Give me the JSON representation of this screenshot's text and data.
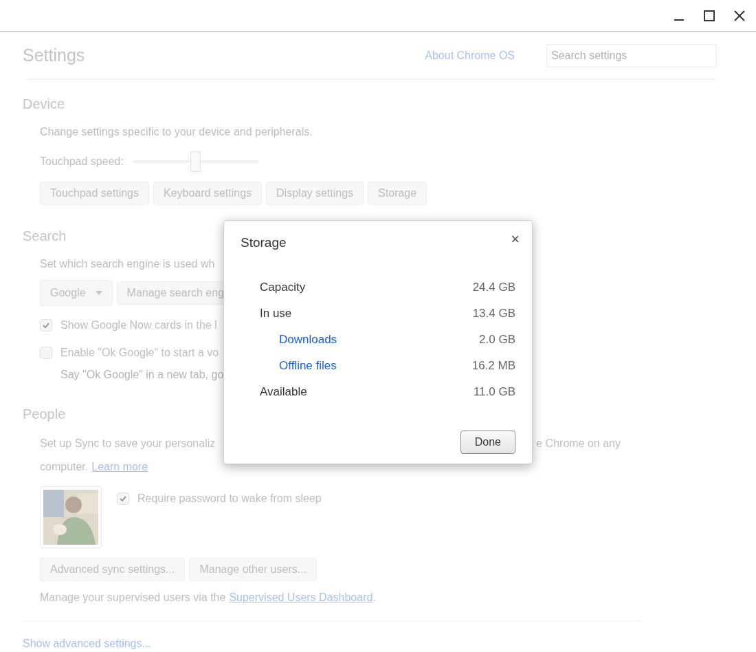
{
  "window": {
    "controls": [
      {
        "kind": "minimize"
      },
      {
        "kind": "maximize"
      },
      {
        "kind": "close"
      }
    ]
  },
  "header": {
    "title": "Settings",
    "link": "About Chrome OS",
    "search": {
      "placeholder": "Search settings"
    }
  },
  "device": {
    "heading": "Device",
    "description": "Change settings specific to your device and peripherals.",
    "slider": {
      "label": "Touchpad speed:",
      "level": 0.5
    },
    "buttons": [
      "Touchpad settings",
      "Keyboard settings",
      "Display settings",
      "Storage"
    ]
  },
  "search": {
    "heading": "Search",
    "description": "Set which search engine is used wh",
    "engine": "Google",
    "manage_button": "Manage search eng",
    "options": [
      {
        "label": "Show Google Now cards in the l",
        "checked": true
      },
      {
        "label": "Enable \"Ok Google\" to start a vo",
        "checked": false,
        "hint": "Say \"Ok Google\" in a new tab, go"
      }
    ]
  },
  "people": {
    "heading": "People",
    "description_left": "Set up Sync to save your personaliz",
    "description_right": "e Chrome on any",
    "description_line2": "computer.",
    "learn_more": "Learn more",
    "option": {
      "label": "Require password to wake from sleep",
      "checked": true
    },
    "buttons": [
      "Advanced sync settings...",
      "Manage other users..."
    ],
    "supervised_text": "Manage your supervised users via the",
    "supervised_link": "Supervised Users Dashboard",
    "supervised_end": "."
  },
  "advanced_link": "Show advanced settings...",
  "dialog": {
    "title": "Storage",
    "close": "×",
    "rows": [
      {
        "label": "Capacity",
        "value": "24.4 GB",
        "kind": "total"
      },
      {
        "label": "In use",
        "value": "13.4 GB",
        "kind": "total"
      },
      {
        "label": "Downloads",
        "value": "2.0 GB",
        "kind": "link"
      },
      {
        "label": "Offline files",
        "value": "16.2 MB",
        "kind": "link"
      },
      {
        "label": "Available",
        "value": "11.0 GB",
        "kind": "total"
      }
    ],
    "button": "Done"
  }
}
